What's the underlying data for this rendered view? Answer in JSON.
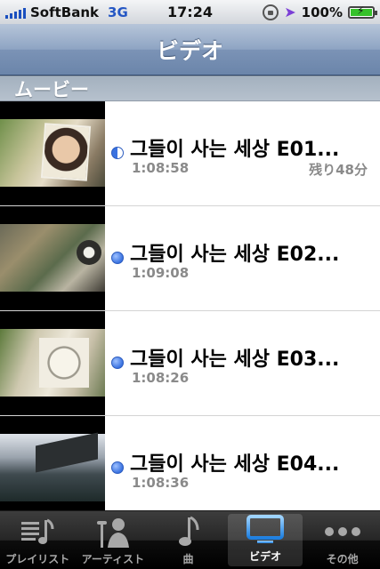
{
  "status_bar": {
    "carrier": "SoftBank",
    "network": "3G",
    "time": "17:24",
    "battery": "100%"
  },
  "nav": {
    "title": "ビデオ"
  },
  "section": {
    "title": "ムービー"
  },
  "rows": [
    {
      "title": "그들이 사는 세상 E01...",
      "duration": "1:08:58",
      "remaining": "残り48分",
      "status": "partially-watched"
    },
    {
      "title": "그들이 사는 세상 E02...",
      "duration": "1:09:08",
      "remaining": "",
      "status": "unwatched"
    },
    {
      "title": "그들이 사는 세상 E03...",
      "duration": "1:08:26",
      "remaining": "",
      "status": "unwatched"
    },
    {
      "title": "그들이 사는 세상 E04...",
      "duration": "1:08:36",
      "remaining": "",
      "status": "unwatched"
    }
  ],
  "tabs": [
    {
      "label": "プレイリスト",
      "icon": "playlist-icon"
    },
    {
      "label": "アーティスト",
      "icon": "artist-icon"
    },
    {
      "label": "曲",
      "icon": "music-note-icon"
    },
    {
      "label": "ビデオ",
      "icon": "tv-icon",
      "selected": true
    },
    {
      "label": "その他",
      "icon": "more-icon"
    }
  ],
  "colors": {
    "nav_bar": "#7b93b6",
    "unwatched_dot": "#3a72e0",
    "secondary_text": "#8a8a8a",
    "battery_fill": "#35c12a"
  }
}
